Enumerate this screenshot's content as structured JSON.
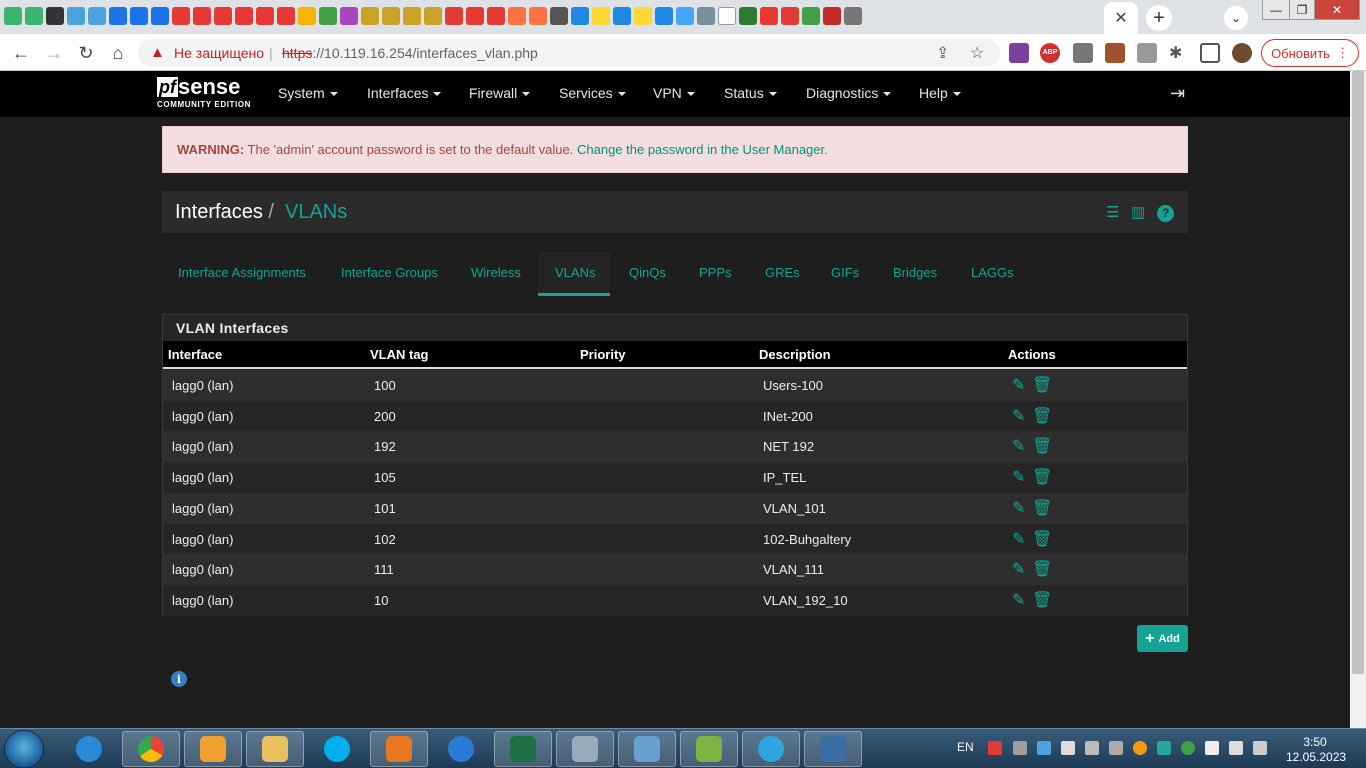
{
  "browser": {
    "tab_close": "✕",
    "new_tab": "+",
    "security_label": "Не защищено",
    "url_scheme": "https",
    "url_rest": "://10.119.16.254/interfaces_vlan.php",
    "update_label": "Обновить",
    "abp_label": "ABP"
  },
  "nav": {
    "logo_pf": "pf",
    "logo_sense": "sense",
    "logo_sub": "COMMUNITY EDITION",
    "menu": [
      "System",
      "Interfaces",
      "Firewall",
      "Services",
      "VPN",
      "Status",
      "Diagnostics",
      "Help"
    ]
  },
  "alert": {
    "label": "WARNING:",
    "text": " The 'admin' account password is set to the default value. ",
    "link": "Change the password in the User Manager."
  },
  "breadcrumb": {
    "parent": "Interfaces",
    "separator": "/",
    "current": "VLANs"
  },
  "tabs": [
    "Interface Assignments",
    "Interface Groups",
    "Wireless",
    "VLANs",
    "QinQs",
    "PPPs",
    "GREs",
    "GIFs",
    "Bridges",
    "LAGGs"
  ],
  "active_tab": "VLANs",
  "panel": {
    "title": "VLAN Interfaces",
    "columns": [
      "Interface",
      "VLAN tag",
      "Priority",
      "Description",
      "Actions"
    ],
    "rows": [
      {
        "interface": "lagg0 (lan)",
        "tag": "100",
        "priority": "",
        "description": "Users-100"
      },
      {
        "interface": "lagg0 (lan)",
        "tag": "200",
        "priority": "",
        "description": "INet-200"
      },
      {
        "interface": "lagg0 (lan)",
        "tag": "192",
        "priority": "",
        "description": "NET 192"
      },
      {
        "interface": "lagg0 (lan)",
        "tag": "105",
        "priority": "",
        "description": "IP_TEL"
      },
      {
        "interface": "lagg0 (lan)",
        "tag": "101",
        "priority": "",
        "description": "VLAN_101"
      },
      {
        "interface": "lagg0 (lan)",
        "tag": "102",
        "priority": "",
        "description": "102-Buhgaltery"
      },
      {
        "interface": "lagg0 (lan)",
        "tag": "111",
        "priority": "",
        "description": "VLAN_111"
      },
      {
        "interface": "lagg0 (lan)",
        "tag": "10",
        "priority": "",
        "description": "VLAN_192_10"
      }
    ]
  },
  "add_button": "Add",
  "info_icon": "i",
  "taskbar": {
    "lang": "EN",
    "time": "3:50",
    "date": "12.05.2023"
  },
  "colors": {
    "accent": "#14a394",
    "alert_bg": "#f2dede",
    "alert_text": "#a94442",
    "nav_bg": "#000000",
    "page_bg": "#1e1e1e"
  },
  "icons": {
    "edit": "pencil-icon",
    "delete": "trash-icon",
    "header_actions": [
      "sliders-icon",
      "chart-icon",
      "help-icon"
    ],
    "logout": "logout-icon"
  }
}
